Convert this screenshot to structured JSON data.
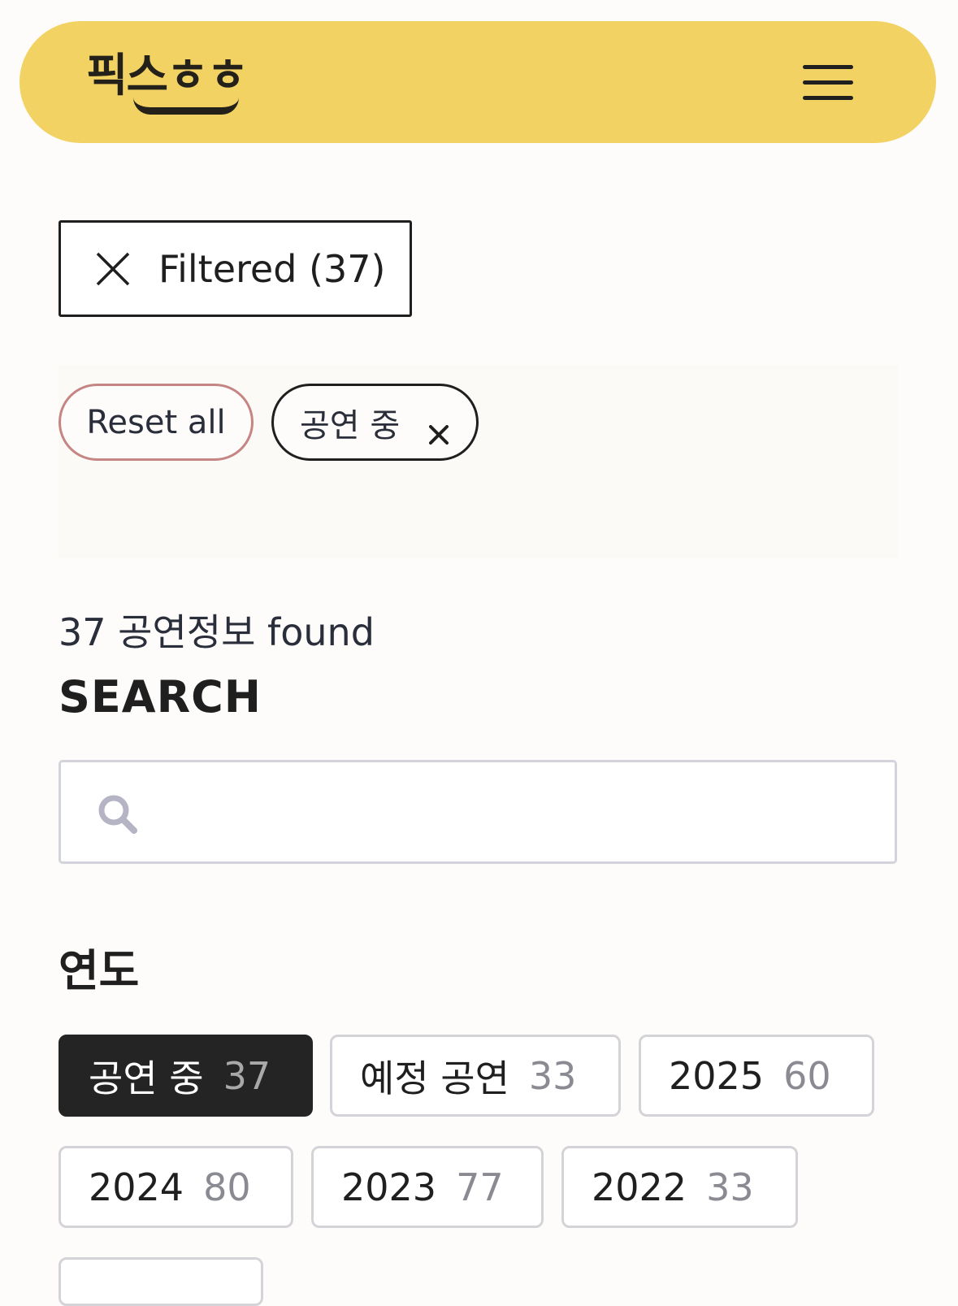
{
  "header": {
    "logo_text": "픽스ㅎㅎ",
    "background_color": "#f2d262",
    "menu_icon": "hamburger-menu-icon"
  },
  "filter_toggle": {
    "label": "Filtered (37)",
    "icon": "close-icon"
  },
  "active_filters": {
    "reset_label": "Reset all",
    "chips": [
      {
        "label": "공연 중",
        "icon": "close-icon"
      }
    ]
  },
  "results": {
    "count_text": "37 공연정보 found"
  },
  "search": {
    "heading": "SEARCH",
    "placeholder": "",
    "value": "",
    "icon": "search-icon"
  },
  "year_facet": {
    "heading": "연도",
    "options": [
      {
        "label": "공연 중",
        "count": "37",
        "selected": true
      },
      {
        "label": "예정 공연",
        "count": "33",
        "selected": false
      },
      {
        "label": "2025",
        "count": "60",
        "selected": false
      },
      {
        "label": "2024",
        "count": "80",
        "selected": false
      },
      {
        "label": "2023",
        "count": "77",
        "selected": false
      },
      {
        "label": "2022",
        "count": "33",
        "selected": false
      }
    ]
  }
}
